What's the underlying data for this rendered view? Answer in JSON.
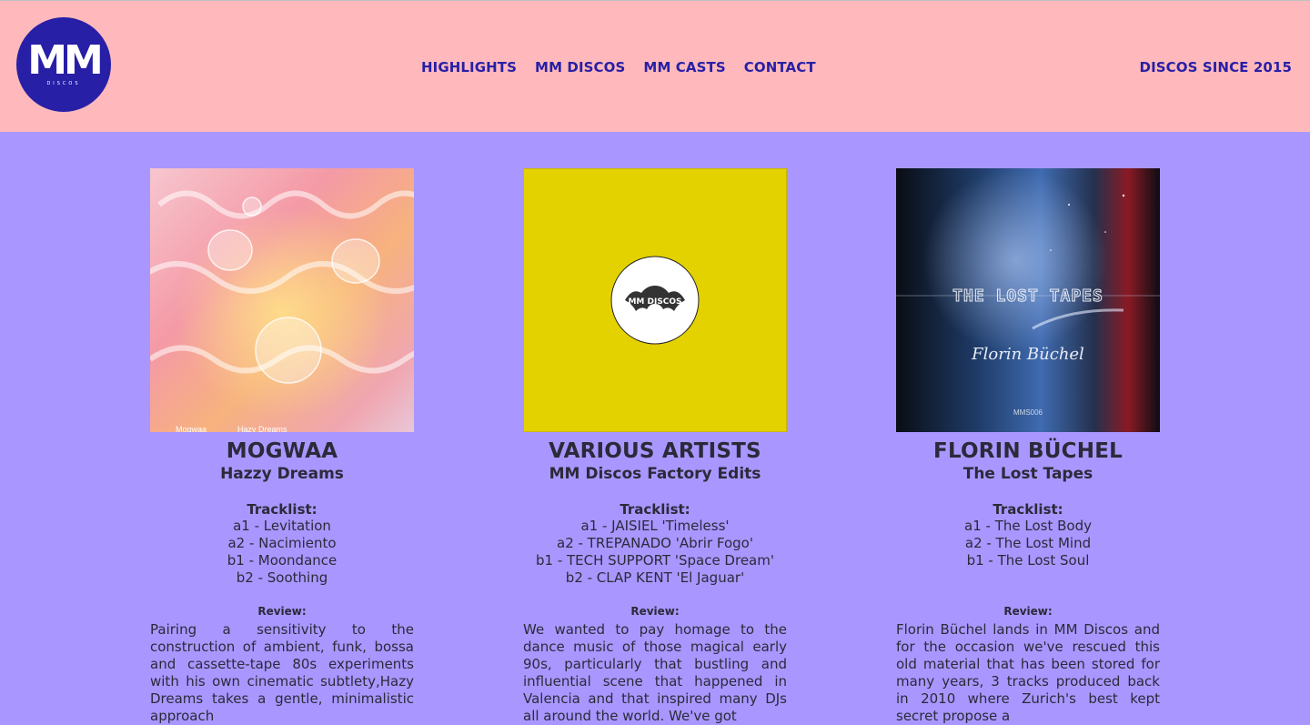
{
  "header": {
    "logo_text": "MM",
    "logo_sub": "DISCOS",
    "nav": [
      "HIGHLIGHTS",
      "MM DISCOS",
      "MM CASTS",
      "CONTACT"
    ],
    "tagline": "DISCOS SINCE 2015"
  },
  "colors": {
    "header_bg": "#ffb9bc",
    "page_bg": "#a997ff",
    "brand_blue": "#271fa6",
    "yellow_cover": "#e3d200"
  },
  "releases": [
    {
      "artist": "MOGWAA",
      "title": "Hazzy Dreams",
      "cover_caption_left": "Mogwaa",
      "cover_caption_right": "Hazy Dreams",
      "tracklist_label": "Tracklist:",
      "tracks": [
        "a1 - Levitation",
        "a2 - Nacimiento",
        "b1 - Moondance",
        "b2 - Soothing"
      ],
      "review_label": "Review:",
      "review": "Pairing a sensitivity to the construction of ambient, funk, bossa and cassette-tape 80s experiments with his own cinematic subtlety,Hazy Dreams takes a gentle, minimalistic approach"
    },
    {
      "artist": "VARIOUS ARTISTS",
      "title": "MM Discos Factory Edits",
      "label_text": "MM DISCOS",
      "tracklist_label": "Tracklist:",
      "tracks": [
        "a1 - JAISIEL 'Timeless'",
        "a2 - TREPANADO 'Abrir Fogo'",
        "b1 - TECH SUPPORT 'Space Dream'",
        "b2 - CLAP KENT 'El Jaguar'"
      ],
      "review_label": "Review:",
      "review": "We wanted to pay homage to the dance music of those magical early 90s, particularly that bustling and influential scene that happened in Valencia and that inspired many DJs all around the world. We've got"
    },
    {
      "artist": "FLORIN BÜCHEL",
      "title": "The Lost Tapes",
      "cover_title": "THE LOST TAPES",
      "cover_signature": "Florin Büchel",
      "cover_cat": "MMS006",
      "tracklist_label": "Tracklist:",
      "tracks": [
        "a1 - The Lost Body",
        "a2 - The Lost Mind",
        "b1 - The Lost Soul"
      ],
      "review_label": "Review:",
      "review": "Florin Büchel lands in MM Discos and for the occasion we've rescued this old material that has been stored for many years, 3 tracks produced back in 2010 where Zurich's best kept secret propose a"
    }
  ]
}
